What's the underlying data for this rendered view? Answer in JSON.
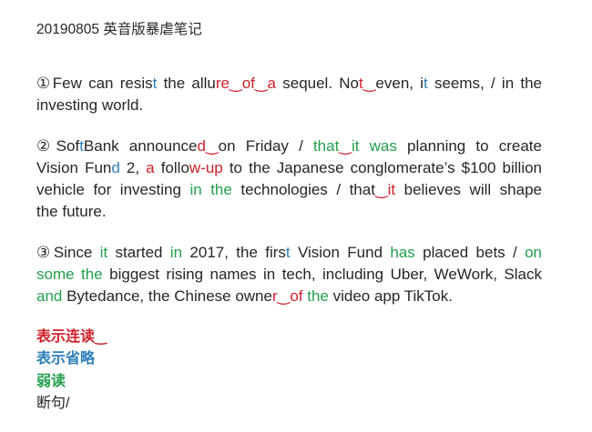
{
  "title": "20190805 英音版暴虐笔记",
  "colors": {
    "text": "#262626",
    "link": "#d0202a",
    "elide": "#2c7fb8",
    "weak": "#22a04b"
  },
  "paragraphs": [
    {
      "lines": [
        [
          {
            "t": "①Few can resis",
            "s": "n"
          },
          {
            "t": "t",
            "s": "b"
          },
          {
            "t": " the allu",
            "s": "n"
          },
          {
            "t": "re",
            "s": "r"
          },
          {
            "t": "‿",
            "s": "r"
          },
          {
            "t": "of",
            "s": "r"
          },
          {
            "t": "‿",
            "s": "r"
          },
          {
            "t": "a",
            "s": "r"
          },
          {
            "t": " sequel. No",
            "s": "n"
          },
          {
            "t": "t",
            "s": "r"
          },
          {
            "t": "‿",
            "s": "r"
          },
          {
            "t": "even, i",
            "s": "n"
          },
          {
            "t": "t",
            "s": "b"
          },
          {
            "t": " seems, / in the",
            "s": "n"
          }
        ],
        [
          {
            "t": "investing world.",
            "s": "n"
          }
        ]
      ]
    },
    {
      "lines": [
        [
          {
            "t": "②Sof",
            "s": "n"
          },
          {
            "t": "t",
            "s": "b"
          },
          {
            "t": "Bank announce",
            "s": "n"
          },
          {
            "t": "d",
            "s": "r"
          },
          {
            "t": "‿",
            "s": "r"
          },
          {
            "t": "on Friday / ",
            "s": "n"
          },
          {
            "t": "that",
            "s": "g"
          },
          {
            "t": "‿",
            "s": "r"
          },
          {
            "t": "it was",
            "s": "g"
          },
          {
            "t": " planning to create",
            "s": "n"
          }
        ],
        [
          {
            "t": "Vision Fun",
            "s": "n"
          },
          {
            "t": "d",
            "s": "b"
          },
          {
            "t": " 2, ",
            "s": "n"
          },
          {
            "t": "a",
            "s": "r"
          },
          {
            "t": " follo",
            "s": "n"
          },
          {
            "t": "w-up",
            "s": "r"
          },
          {
            "t": " to the Japanese conglomerate’s $100 billion",
            "s": "n"
          }
        ],
        [
          {
            "t": "vehicle for investing ",
            "s": "n"
          },
          {
            "t": "in the",
            "s": "g"
          },
          {
            "t": " technologies / that",
            "s": "n"
          },
          {
            "t": "‿",
            "s": "r"
          },
          {
            "t": "it",
            "s": "r"
          },
          {
            "t": " believes will shape",
            "s": "n"
          }
        ],
        [
          {
            "t": "the future.",
            "s": "n"
          }
        ]
      ]
    },
    {
      "lines": [
        [
          {
            "t": "③Since ",
            "s": "n"
          },
          {
            "t": "it",
            "s": "g"
          },
          {
            "t": " started ",
            "s": "n"
          },
          {
            "t": "in",
            "s": "g"
          },
          {
            "t": " 2017, the firs",
            "s": "n"
          },
          {
            "t": "t",
            "s": "b"
          },
          {
            "t": " Vision Fund ",
            "s": "n"
          },
          {
            "t": "has",
            "s": "g"
          },
          {
            "t": " placed bets / ",
            "s": "n"
          },
          {
            "t": "on",
            "s": "g"
          }
        ],
        [
          {
            "t": "some the",
            "s": "g"
          },
          {
            "t": " biggest rising names in tech, including Uber, WeWork, Slack",
            "s": "n"
          }
        ],
        [
          {
            "t": "and",
            "s": "g"
          },
          {
            "t": " Bytedance, the Chinese owne",
            "s": "n"
          },
          {
            "t": "r",
            "s": "r"
          },
          {
            "t": "‿",
            "s": "r"
          },
          {
            "t": "of",
            "s": "r"
          },
          {
            "t": " ",
            "s": "n"
          },
          {
            "t": "the",
            "s": "g"
          },
          {
            "t": " video app TikTok.",
            "s": "n"
          }
        ]
      ]
    }
  ],
  "legend": [
    {
      "text": "表示连读‿",
      "s": "r"
    },
    {
      "text": "表示省略",
      "s": "b"
    },
    {
      "text": "弱读",
      "s": "g"
    },
    {
      "text": "断句/",
      "s": "n"
    }
  ]
}
